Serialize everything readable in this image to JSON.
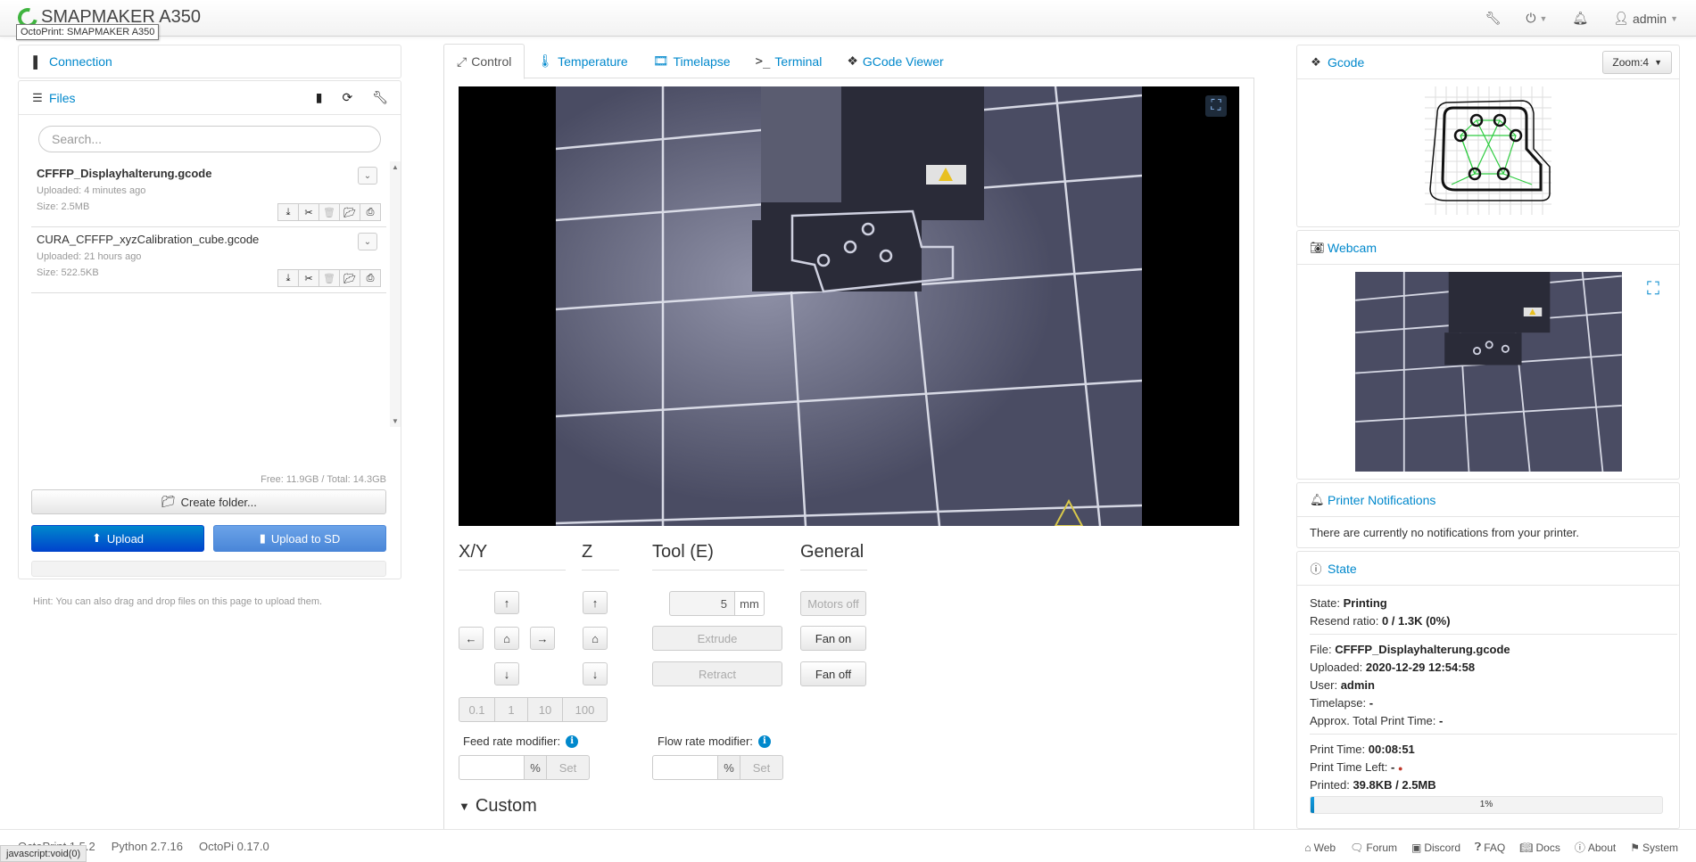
{
  "navbar": {
    "brand": "SMAPMAKER A350",
    "tooltip": "OctoPrint: SMAPMAKER A350",
    "user": "admin"
  },
  "sidebar": {
    "connection_label": "Connection",
    "files_label": "Files",
    "search_placeholder": "Search...",
    "files": [
      {
        "name": "CFFFP_Displayhalterung.gcode",
        "uploaded": "Uploaded: 4 minutes ago",
        "size": "Size: 2.5MB"
      },
      {
        "name": "CURA_CFFFP_xyzCalibration_cube.gcode",
        "uploaded": "Uploaded: 21 hours ago",
        "size": "Size: 522.5KB"
      }
    ],
    "free_total": "Free: 11.9GB / Total: 14.3GB",
    "create_folder": "Create folder...",
    "upload": "Upload",
    "upload_sd": "Upload to SD",
    "hint": "Hint: You can also drag and drop files on this page to upload them."
  },
  "tabs": [
    {
      "label": "Control"
    },
    {
      "label": "Temperature"
    },
    {
      "label": "Timelapse"
    },
    {
      "label": "Terminal"
    },
    {
      "label": "GCode Viewer"
    }
  ],
  "control": {
    "xy_title": "X/Y",
    "z_title": "Z",
    "tool_title": "Tool (E)",
    "general_title": "General",
    "extrude_amount": "5",
    "unit_mm": "mm",
    "extrude": "Extrude",
    "retract": "Retract",
    "motors_off": "Motors off",
    "fan_on": "Fan on",
    "fan_off": "Fan off",
    "steps": [
      "0.1",
      "1",
      "10",
      "100"
    ],
    "feed_rate_label": "Feed rate modifier:",
    "flow_rate_label": "Flow rate modifier:",
    "percent": "%",
    "set": "Set",
    "custom": "Custom"
  },
  "right": {
    "gcode_label": "Gcode",
    "zoom_label": "Zoom:4",
    "webcam_label": "Webcam",
    "notifications_label": "Printer Notifications",
    "notifications_text": "There are currently no notifications from your printer.",
    "state_label": "State",
    "state": {
      "state_k": "State:",
      "state_v": "Printing",
      "resend_k": "Resend ratio:",
      "resend_v": "0 / 1.3K (0%)",
      "file_k": "File:",
      "file_v": "CFFFP_Displayhalterung.gcode",
      "uploaded_k": "Uploaded:",
      "uploaded_v": "2020-12-29 12:54:58",
      "user_k": "User:",
      "user_v": "admin",
      "timelapse_k": "Timelapse:",
      "timelapse_v": "-",
      "approx_k": "Approx. Total Print Time:",
      "approx_v": "-",
      "print_time_k": "Print Time:",
      "print_time_v": "00:08:51",
      "time_left_k": "Print Time Left:",
      "time_left_v": "-",
      "printed_k": "Printed:",
      "printed_v": "39.8KB / 2.5MB",
      "progress_text": "1%",
      "progress_value": 0.01
    }
  },
  "footer": {
    "octoprint": "OctoPrint 1.5.2",
    "python": "Python 2.7.16",
    "octopi": "OctoPi 0.17.0",
    "links": [
      "Web",
      "Forum",
      "Discord",
      "FAQ",
      "Docs",
      "About",
      "System"
    ]
  },
  "statusbar": "javascript:void(0)",
  "colors": {
    "link": "#0088cc",
    "primary": "#0044cc",
    "brand_green": "#3fb43f"
  }
}
